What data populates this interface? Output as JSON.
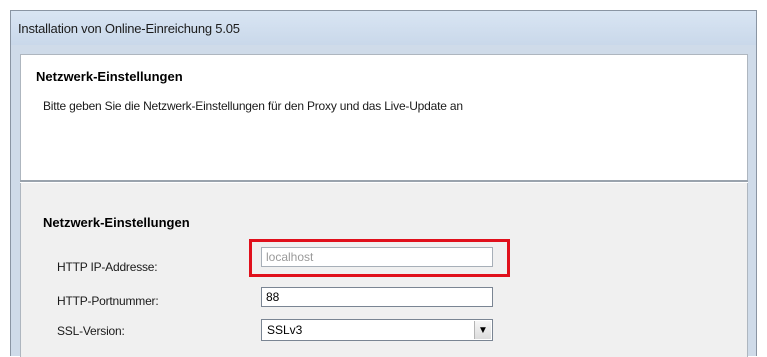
{
  "window": {
    "title": "Installation von Online-Einreichung 5.05"
  },
  "header": {
    "title": "Netzwerk-Einstellungen",
    "description": "Bitte geben Sie die Netzwerk-Einstellungen für den Proxy und das Live-Update an"
  },
  "section": {
    "title": "Netzwerk-Einstellungen",
    "fields": {
      "ip": {
        "label": "HTTP IP-Addresse:",
        "value": "localhost",
        "disabled": true
      },
      "port": {
        "label": "HTTP-Portnummer:",
        "value": "88"
      },
      "ssl": {
        "label": "SSL-Version:",
        "value": "SSLv3",
        "arrow": "▼"
      }
    }
  },
  "colors": {
    "highlight": "#e0101c",
    "title_bar": "#cfdbe9"
  },
  "icons": {
    "dropdown": "chevron-down-icon"
  }
}
